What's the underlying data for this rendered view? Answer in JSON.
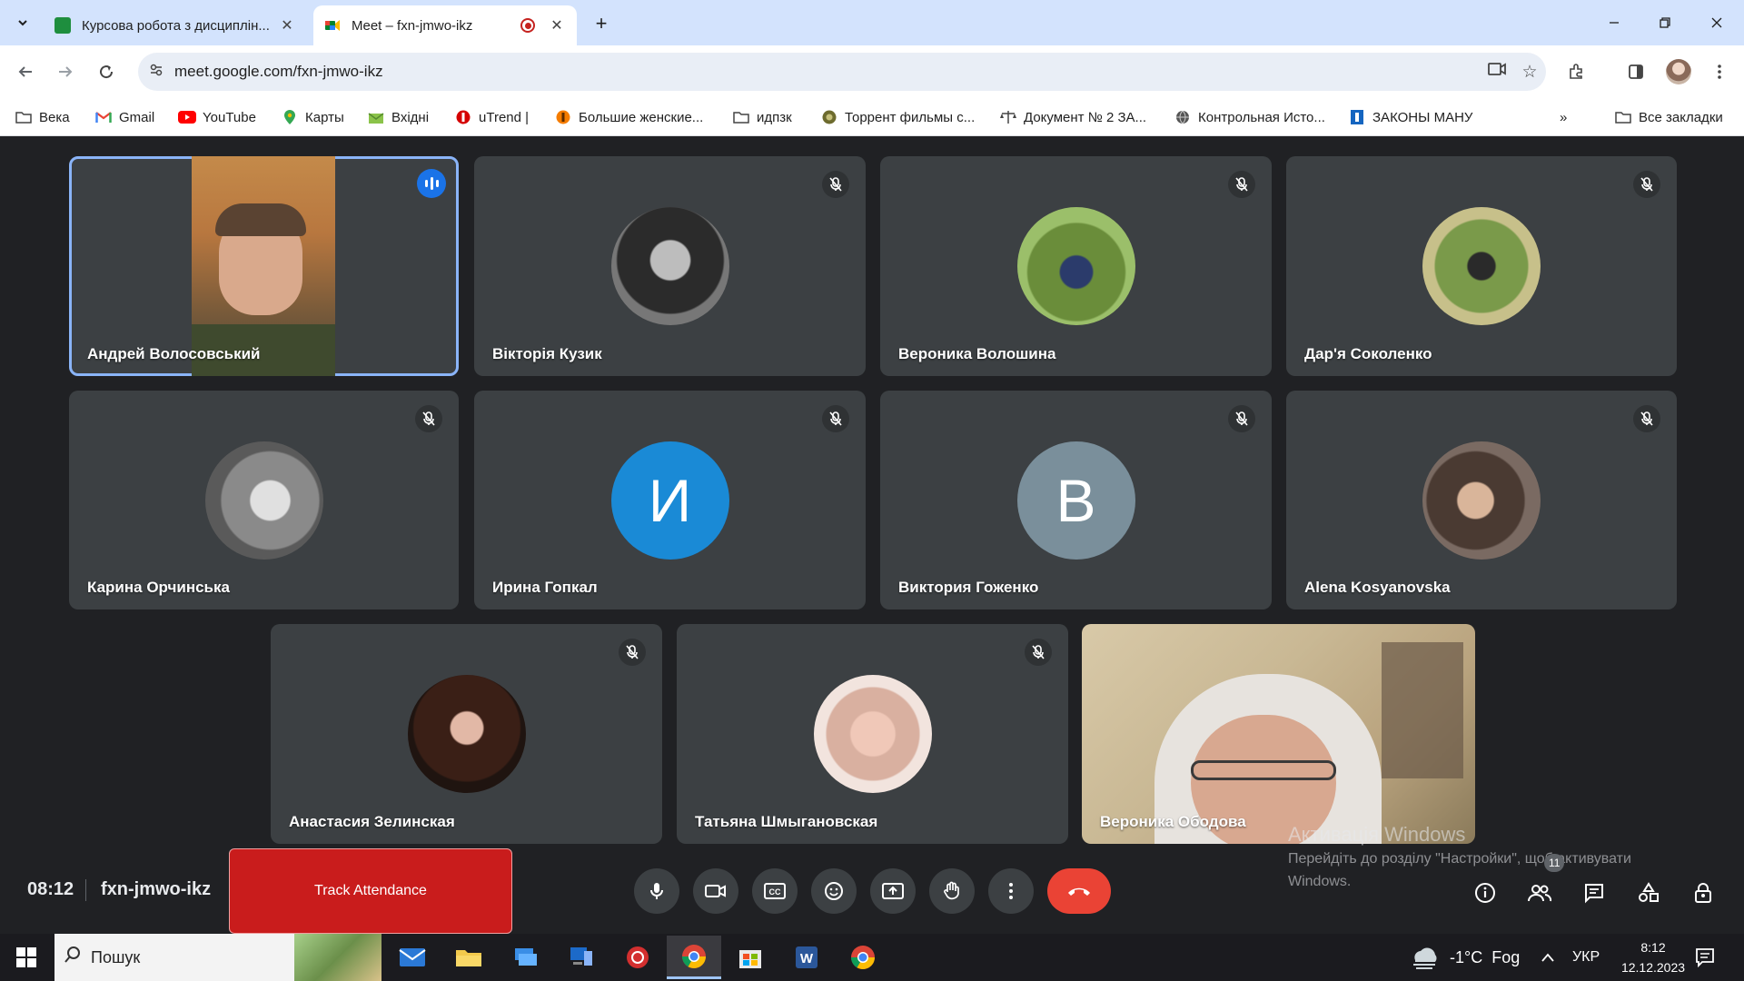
{
  "browser": {
    "tabs": [
      {
        "title": "Курсова робота з дисциплін...",
        "icon": "classroom-icon",
        "active": false
      },
      {
        "title": "Meet – fxn-jmwo-ikz",
        "icon": "meet-icon",
        "active": true,
        "recording": true
      }
    ],
    "url": "meet.google.com/fxn-jmwo-ikz",
    "bookmarks": [
      {
        "label": "Века",
        "icon": "folder-icon"
      },
      {
        "label": "Gmail",
        "icon": "gmail-icon"
      },
      {
        "label": "YouTube",
        "icon": "youtube-icon"
      },
      {
        "label": "Карты",
        "icon": "maps-icon"
      },
      {
        "label": "Вхідні",
        "icon": "inbox-icon"
      },
      {
        "label": "uTrend |",
        "icon": "utrend-icon"
      },
      {
        "label": "Большие женские...",
        "icon": "site-icon"
      },
      {
        "label": "идпзк",
        "icon": "folder-icon"
      },
      {
        "label": "Торрент фильмы с...",
        "icon": "torrent-icon"
      },
      {
        "label": "Документ № 2 ЗА...",
        "icon": "scales-icon"
      },
      {
        "label": "Контрольная Исто...",
        "icon": "globe-icon"
      },
      {
        "label": "ЗАКОНЫ МАНУ",
        "icon": "site-icon"
      }
    ],
    "all_bookmarks": "Все закладки"
  },
  "participants": [
    {
      "name": "Андрей Волосовський",
      "type": "video",
      "speaking": true,
      "muted": false
    },
    {
      "name": "Вікторія Кузик",
      "type": "photo",
      "muted": true
    },
    {
      "name": "Вероника Волошина",
      "type": "photo",
      "muted": true
    },
    {
      "name": "Дар'я Соколенко",
      "type": "photo",
      "muted": true
    },
    {
      "name": "Карина Орчинська",
      "type": "photo",
      "muted": true
    },
    {
      "name": "Ирина Гопкал",
      "type": "letter",
      "letter": "И",
      "color": "#1a8ad6",
      "muted": true
    },
    {
      "name": "Виктория Гоженко",
      "type": "letter",
      "letter": "В",
      "color": "#7a8f9b",
      "muted": true
    },
    {
      "name": "Alena Kosyanovska",
      "type": "photo",
      "muted": true
    },
    {
      "name": "Анастасия Зелинская",
      "type": "photo",
      "muted": true
    },
    {
      "name": "Татьяна Шмыгановская",
      "type": "photo",
      "muted": true
    },
    {
      "name": "Вероника Ободова",
      "type": "video",
      "muted": false
    }
  ],
  "meeting": {
    "time": "08:12",
    "code": "fxn-jmwo-ikz",
    "track_attendance": "Track Attendance",
    "people_count": "11",
    "leave_color": "#ea4335"
  },
  "activation": {
    "title": "Активація Windows",
    "text": "Перейдіть до розділу \"Настройки\", щоб активувати Windows."
  },
  "taskbar": {
    "search_placeholder": "Пошук",
    "weather": "-1°C  Fog",
    "lang": "УКР",
    "time": "8:12",
    "date": "12.12.2023"
  }
}
